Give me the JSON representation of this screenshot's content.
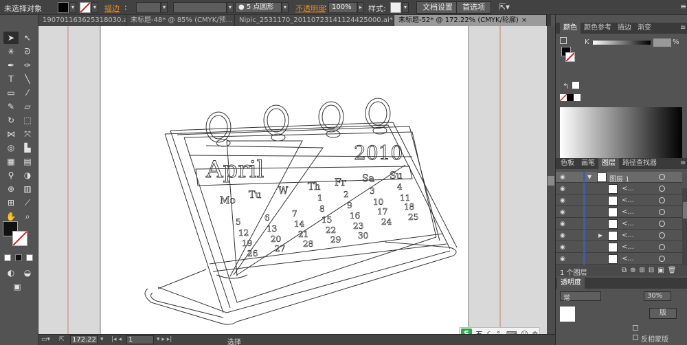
{
  "control_bar": {
    "selection_label": "未选择对象",
    "stroke_label": "描边",
    "brush_label": "5 点圆形",
    "opacity_label": "不透明度",
    "opacity_value": "100%",
    "style_label": "样式",
    "doc_settings_button": "文档设置",
    "prefs_button": "首选项"
  },
  "tabs": [
    {
      "label": "190701163625318030.ai*",
      "active": false
    },
    {
      "label": "未标题-48* @ 85% (CMYK/预...",
      "active": false
    },
    {
      "label": "Nipic_2531170_20110723141124425000.ai*",
      "active": false
    },
    {
      "label": "未标题-52* @ 172.22% (CMYK/轮廓)",
      "active": true
    }
  ],
  "canvas": {
    "month": "April",
    "year": "2010",
    "weekdays": [
      "Mo",
      "Tu",
      "W",
      "Th",
      "Fr",
      "Sa",
      "Su"
    ],
    "dates": [
      "1",
      "2",
      "3",
      "4",
      "5",
      "6",
      "7",
      "8",
      "9",
      "10",
      "11",
      "12",
      "13",
      "14",
      "15",
      "16",
      "17",
      "18",
      "19",
      "20",
      "21",
      "22",
      "23",
      "24",
      "25",
      "26",
      "27",
      "28",
      "29",
      "30"
    ]
  },
  "status": {
    "zoom": "172.22",
    "page": "1",
    "tool_status": "选择"
  },
  "ime": {
    "badge": "S",
    "mode": "五"
  },
  "right_panel": {
    "top_tabs": [
      "颜色",
      "颜色参考",
      "描边",
      "渐变"
    ],
    "k_label": "K",
    "layer_tabs": [
      "色板",
      "画笔",
      "图层",
      "路径查找器"
    ],
    "layer_top": "图层 1",
    "layer_items": [
      "<...",
      "<...",
      "<...",
      "<...",
      "<...",
      "<...",
      "<..."
    ],
    "layer_count": "1 个图层",
    "transparency_label": "透明度",
    "blend_mode": "常",
    "transparency_value": "30%",
    "make_mask_button": "版",
    "invert_mask_label": "反相蒙版"
  },
  "colors": {
    "accent_orange": "#e08a2c",
    "layer_blue": "#3d5ea8"
  }
}
